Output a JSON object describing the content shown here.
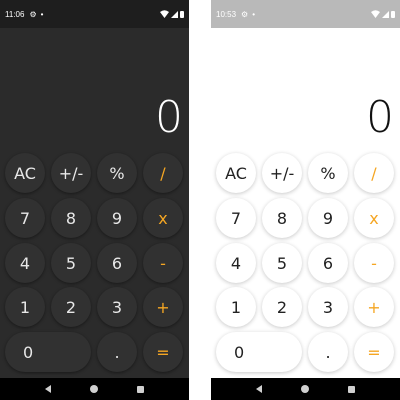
{
  "dark": {
    "status": {
      "time": "11:06"
    },
    "display": "0",
    "keys": {
      "ac": "AC",
      "sign": "+/-",
      "percent": "%",
      "divide": "/",
      "seven": "7",
      "eight": "8",
      "nine": "9",
      "multiply": "x",
      "four": "4",
      "five": "5",
      "six": "6",
      "minus": "-",
      "one": "1",
      "two": "2",
      "three": "3",
      "plus": "+",
      "zero": "0",
      "decimal": ".",
      "equals": "="
    }
  },
  "light": {
    "status": {
      "time": "10:53"
    },
    "display": "0",
    "keys": {
      "ac": "AC",
      "sign": "+/-",
      "percent": "%",
      "divide": "/",
      "seven": "7",
      "eight": "8",
      "nine": "9",
      "multiply": "x",
      "four": "4",
      "five": "5",
      "six": "6",
      "minus": "-",
      "one": "1",
      "two": "2",
      "three": "3",
      "plus": "+",
      "zero": "0",
      "decimal": ".",
      "equals": "="
    }
  },
  "icons": {
    "status": [
      "gear-icon",
      "notification-dot-icon",
      "wifi-icon",
      "signal-icon",
      "battery-icon"
    ],
    "nav": [
      "back-icon",
      "home-icon",
      "recents-icon"
    ]
  },
  "colors": {
    "dark_background": "#2b2b2b",
    "light_background": "#ffffff",
    "operator_accent": "#f5a623"
  }
}
